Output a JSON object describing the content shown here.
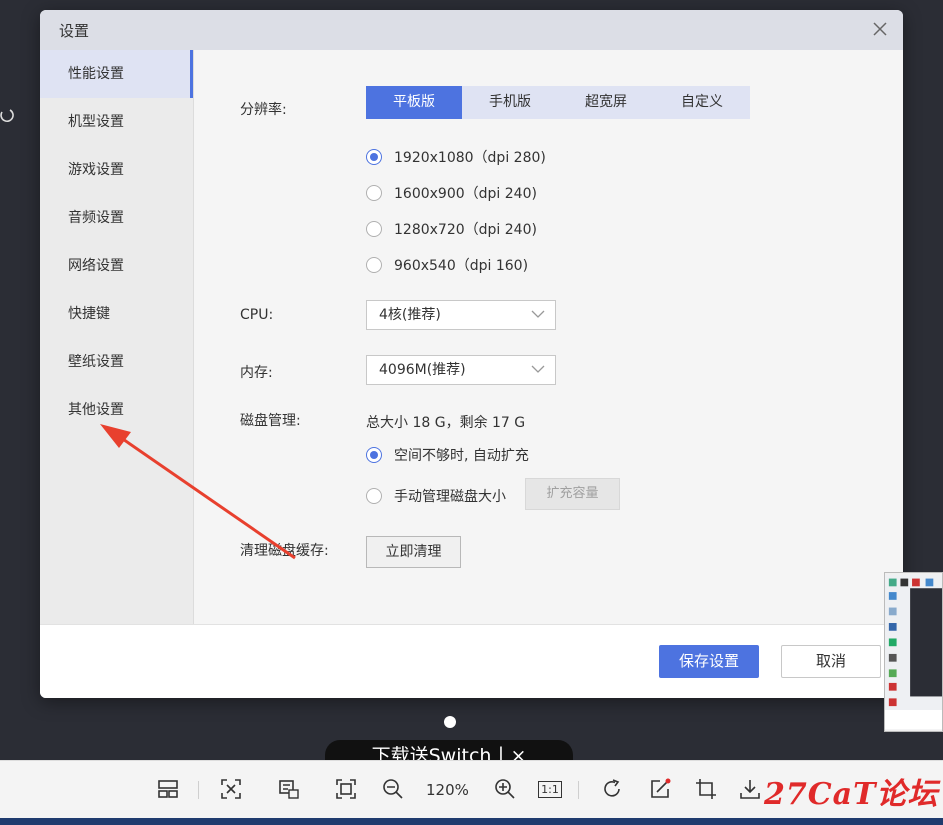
{
  "dialog": {
    "title": "设置",
    "close_label": "×"
  },
  "sidebar": {
    "items": [
      {
        "label": "性能设置",
        "active": true
      },
      {
        "label": "机型设置"
      },
      {
        "label": "游戏设置"
      },
      {
        "label": "音频设置"
      },
      {
        "label": "网络设置"
      },
      {
        "label": "快捷键"
      },
      {
        "label": "壁纸设置"
      },
      {
        "label": "其他设置"
      }
    ]
  },
  "performance": {
    "resolution_label": "分辨率:",
    "tabs": [
      "平板版",
      "手机版",
      "超宽屏",
      "自定义"
    ],
    "active_tab": "平板版",
    "resolutions": [
      {
        "label": "1920x1080（dpi 280)",
        "checked": true
      },
      {
        "label": "1600x900（dpi 240)"
      },
      {
        "label": "1280x720（dpi 240)"
      },
      {
        "label": "960x540（dpi 160)"
      }
    ],
    "cpu_label": "CPU:",
    "cpu_value": "4核(推荐)",
    "memory_label": "内存:",
    "memory_value": "4096M(推荐)",
    "disk_label": "磁盘管理:",
    "disk_info": "总大小 18 G，剩余 17 G",
    "disk_auto": "空间不够时, 自动扩充",
    "disk_manual": "手动管理磁盘大小",
    "expand_button": "扩充容量",
    "cache_label": "清理磁盘缓存:",
    "clean_button": "立即清理"
  },
  "footer": {
    "save_button": "保存设置",
    "cancel_button": "取消"
  },
  "overlay": {
    "banner_text": "下载送Switch丨×"
  },
  "viewer_toolbar": {
    "zoom": "120%",
    "one_to_one": "1:1"
  },
  "watermark": "27CaT论坛",
  "colors": {
    "accent": "#4d73e0",
    "arrow": "#e8402e",
    "watermark": "#e02a2a"
  }
}
